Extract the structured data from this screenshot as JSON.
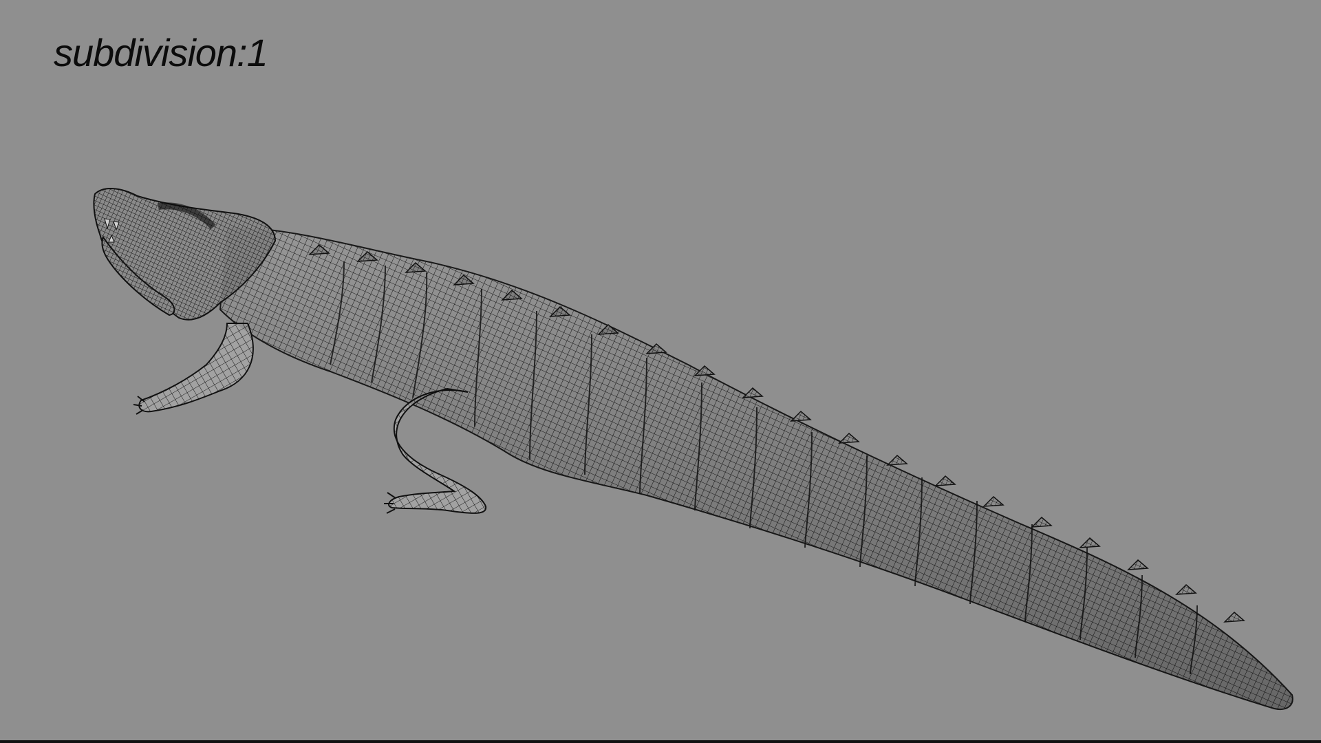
{
  "viewport": {
    "overlay_label": "subdivision:1",
    "background_color": "#8f8f8f",
    "mesh_fill_color": "#9c9c9c",
    "wire_color": "#141414"
  },
  "model": {
    "subject": "crocodile-wireframe-mesh"
  }
}
